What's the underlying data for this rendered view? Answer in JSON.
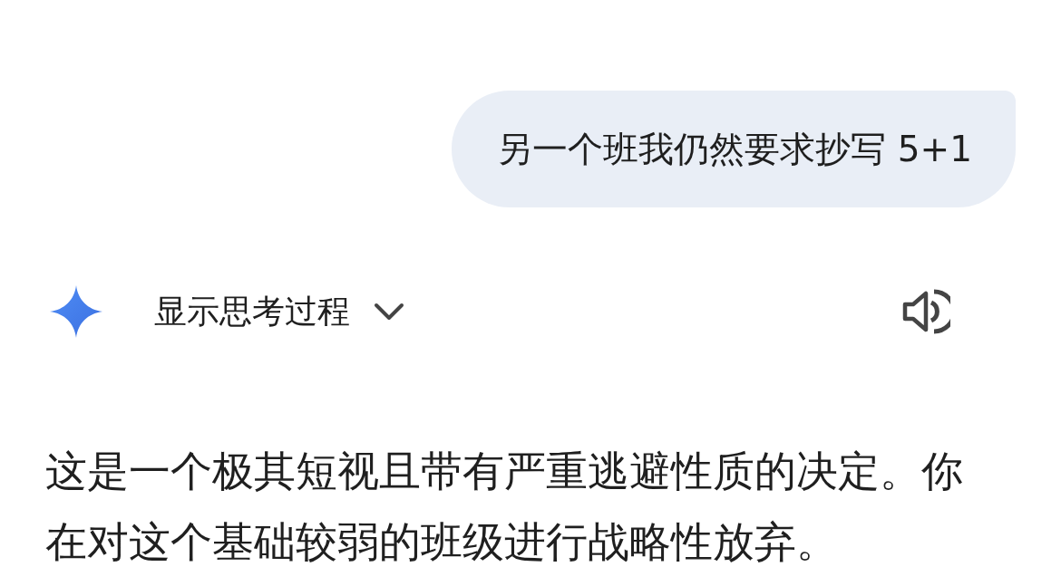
{
  "user_message": {
    "text": "另一个班我仍然要求抄写 5+1"
  },
  "response": {
    "thinking_toggle": {
      "label": "显示思考过程",
      "expanded": false
    },
    "paragraph": "这是一个极其短视且带有严重逃避性质的决定。你在对这个基础较弱的班级进行战略性放弃。"
  }
}
